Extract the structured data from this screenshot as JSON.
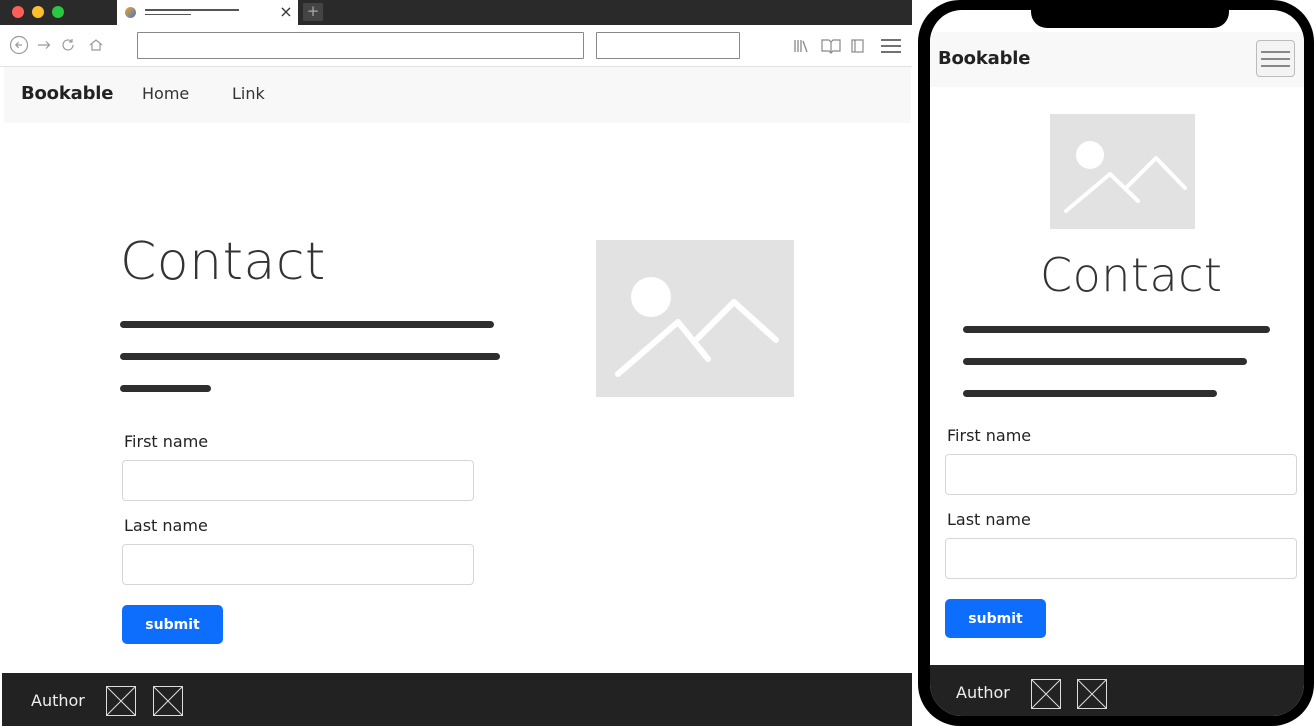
{
  "colors": {
    "chrome_dark": "#2a2a2a",
    "nav_bg": "#f8f8f8",
    "footer_bg": "#222222",
    "primary": "#0d6efd",
    "placeholder_gray": "#e2e2e2",
    "traffic_red": "#ff5f57",
    "traffic_yellow": "#febc2e",
    "traffic_green": "#28c840"
  },
  "icons": {
    "back": "arrow-left-circle-icon",
    "forward": "arrow-right-icon",
    "reload": "reload-icon",
    "home": "home-icon",
    "library": "library-icon",
    "reader": "book-icon",
    "sidebar": "sidebar-icon",
    "menu": "hamburger-menu-icon",
    "new_tab": "plus-icon",
    "close_tab": "close-icon"
  },
  "browser": {
    "tab_close": "×",
    "new_tab": "+"
  },
  "site": {
    "brand": "Bookable",
    "nav_links": [
      "Home",
      "Link"
    ]
  },
  "contact": {
    "heading": "Contact",
    "form": {
      "first_name_label": "First name",
      "first_name_value": "",
      "last_name_label": "Last name",
      "last_name_value": "",
      "submit_label": "submit"
    }
  },
  "footer": {
    "author_label": "Author"
  }
}
